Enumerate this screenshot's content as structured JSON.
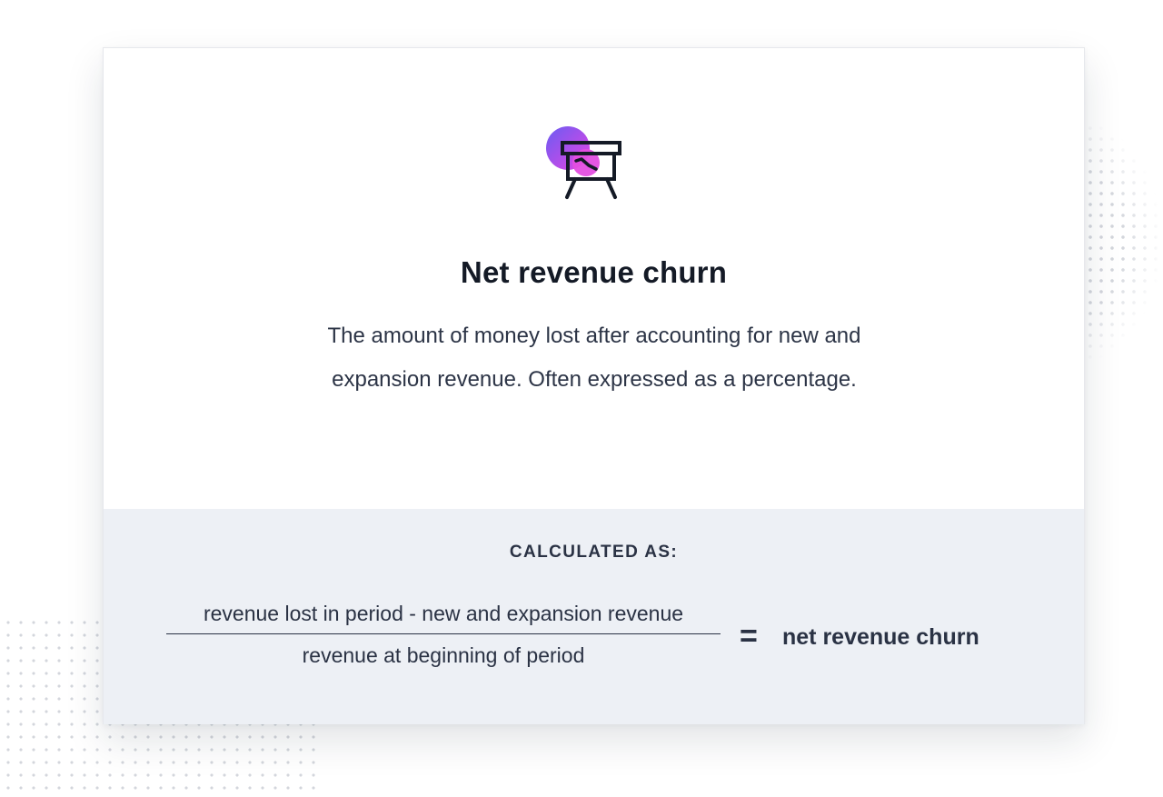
{
  "card": {
    "icon": "presentation-board-chart-icon",
    "title": "Net revenue churn",
    "description": "The amount of money lost after accounting for new and expansion revenue. Often expressed as a percentage."
  },
  "formula": {
    "label": "CALCULATED AS:",
    "numerator": "revenue lost in period - new and expansion revenue",
    "denominator": "revenue at beginning of period",
    "equals": "=",
    "result": "net revenue churn"
  },
  "colors": {
    "accent_purple": "#6a5cf2",
    "accent_magenta": "#e34ee0",
    "panel_background": "#edf0f5",
    "text_dark": "#141a26"
  }
}
